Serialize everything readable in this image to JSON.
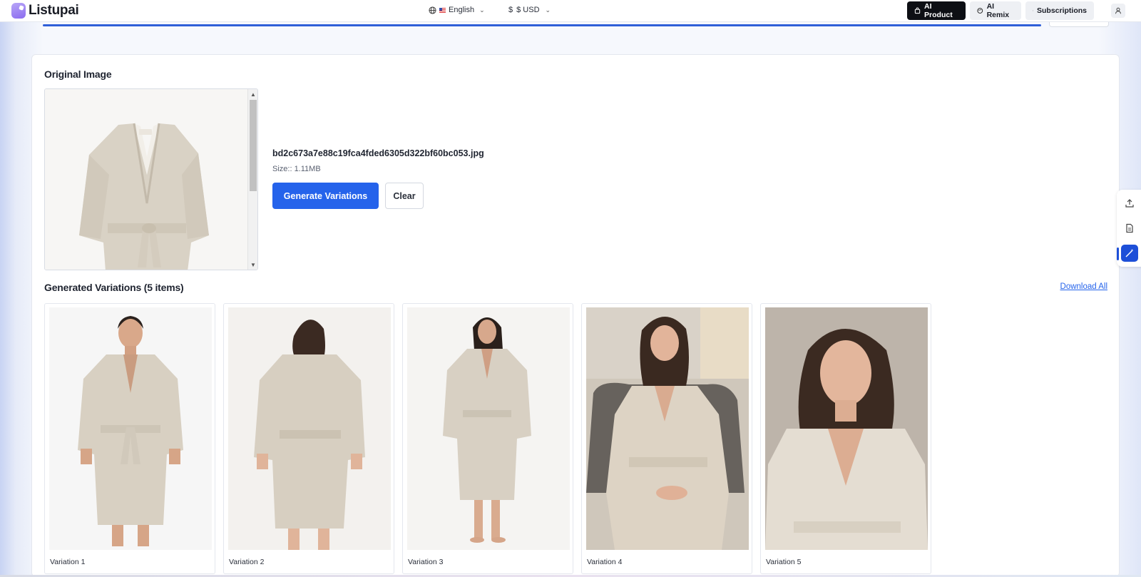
{
  "header": {
    "logo_text": "Listupai",
    "language": "English",
    "currency": "$ USD",
    "currency_symbol": "$",
    "buttons": {
      "ai_product": "AI Product",
      "ai_remix": "AI Remix",
      "subscriptions": "Subscriptions"
    }
  },
  "original": {
    "heading": "Original Image",
    "file_name": "bd2c673a7e88c19fca4fded6305d322bf60bc053.jpg",
    "file_size": "Size:: 1.11MB",
    "generate_label": "Generate Variations",
    "clear_label": "Clear"
  },
  "generated": {
    "heading": "Generated Variations (5 items)",
    "download_all": "Download All",
    "items": [
      {
        "label": "Variation 1"
      },
      {
        "label": "Variation 2"
      },
      {
        "label": "Variation 3"
      },
      {
        "label": "Variation 4"
      },
      {
        "label": "Variation 5"
      }
    ]
  },
  "side_tools": {
    "icons": [
      "upload-icon",
      "document-icon",
      "magic-wand-icon"
    ]
  },
  "colors": {
    "accent": "#2563eb",
    "primary_dark": "#0d0f14",
    "tool_active": "#1d4fd8"
  }
}
